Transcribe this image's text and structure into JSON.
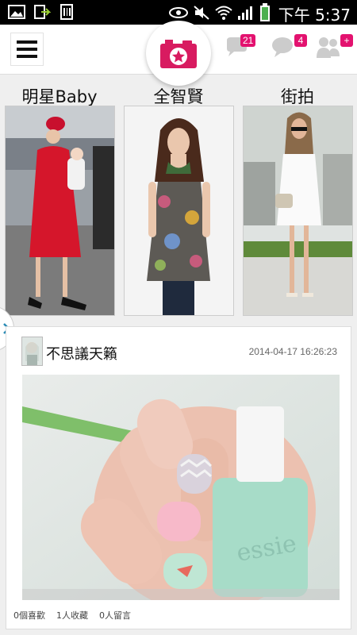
{
  "status_bar": {
    "time": "下午 5:37",
    "left_icons": [
      "image-icon",
      "download-icon",
      "barcode-icon"
    ],
    "right_icons": [
      "eye-icon",
      "mute-icon",
      "wifi-icon",
      "signal-icon",
      "battery-icon"
    ]
  },
  "app_bar": {
    "menu_icon": "menu-icon",
    "camera_icon": "camera-icon",
    "notifications": [
      {
        "icon": "comment-icon",
        "count": "21"
      },
      {
        "icon": "chat-icon",
        "count": "4"
      },
      {
        "icon": "friends-icon",
        "count": "+"
      }
    ]
  },
  "categories": [
    {
      "label": "明星Baby"
    },
    {
      "label": "全智賢"
    },
    {
      "label": "街拍"
    }
  ],
  "post": {
    "author": "不思議天籟",
    "timestamp": "2014-04-17 16:26:23",
    "stats": {
      "likes": "0個喜歡",
      "favorites": "1人收藏",
      "comments": "0人留言"
    }
  },
  "colors": {
    "accent": "#e3126f",
    "status_bar": "#000000"
  }
}
